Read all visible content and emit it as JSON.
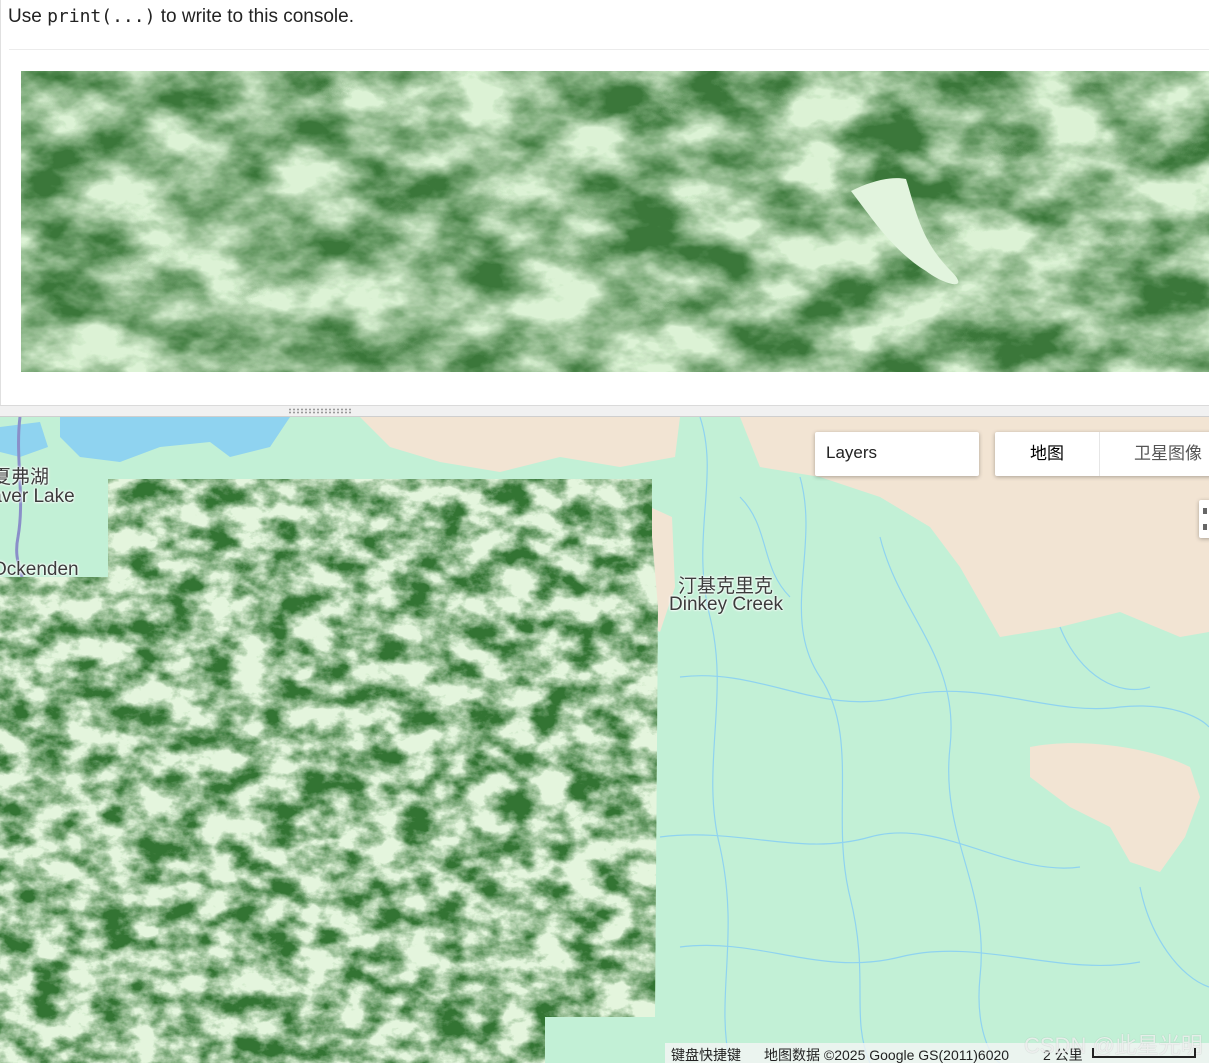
{
  "console": {
    "hint_prefix": "Use ",
    "hint_code": "print(...)",
    "hint_suffix": " to write to this console."
  },
  "map": {
    "layers_label": "Layers",
    "map_type": {
      "map_label": "地图",
      "satellite_label": "卫星图像"
    },
    "labels": {
      "lake_cn": "夏弗湖",
      "lake_en": "Shaver Lake",
      "ockenden": "Ockenden",
      "dinkey_cn": "汀基克里克",
      "dinkey_en": "Dinkey Creek"
    },
    "footer": {
      "shortcuts": "键盘快捷键",
      "attribution": "地图数据 ©2025 Google GS(2011)6020",
      "scale": "2 公里"
    },
    "watermark": "CSDN @此星光明"
  },
  "colors": {
    "ndvi_low": "#e6f7df",
    "ndvi_mid": "#94c490",
    "ndvi_high": "#2a6b2a",
    "terrain": "#c2f0d6",
    "water": "#8fd3f0",
    "urban": "#f2e4d3"
  }
}
